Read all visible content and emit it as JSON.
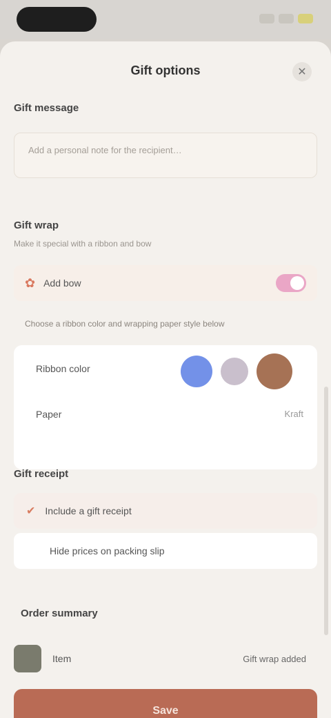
{
  "status": {
    "time": ""
  },
  "sheet": {
    "title": "Gift options",
    "close_glyph": "✕"
  },
  "message": {
    "label": "Gift message",
    "placeholder": "Add a personal note for the recipient…"
  },
  "wrap": {
    "label": "Gift wrap",
    "subtitle": "Make it special with a ribbon and bow",
    "bow_label": "Add bow",
    "hint": "Choose a ribbon color and wrapping paper style below",
    "ribbon_label": "Ribbon color",
    "paper_label": "Paper",
    "paper_value": "Kraft",
    "swatch_colors": [
      "#7391e8",
      "#c9bfcc",
      "#a67255"
    ]
  },
  "delivery": {
    "label": "Gift receipt",
    "option_a": "Include a gift receipt",
    "option_b": "Hide prices on packing slip"
  },
  "summary": {
    "label": "Order summary",
    "item_name": "Item",
    "item_price": "Gift wrap added"
  },
  "cta": {
    "label": "Save"
  }
}
